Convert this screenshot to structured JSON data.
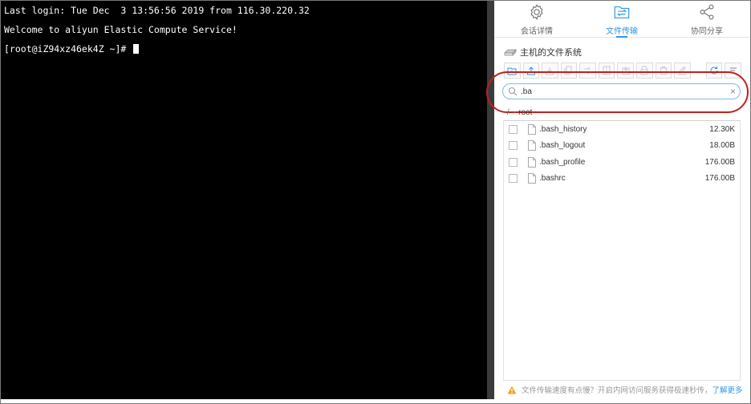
{
  "terminal": {
    "lines": [
      "Last login: Tue Dec  3 13:56:56 2019 from 116.30.220.32",
      "Welcome to aliyun Elastic Compute Service!",
      "[root@iZ94xz46ek4Z ~]# "
    ]
  },
  "tabs": [
    {
      "label": "会话详情",
      "icon": "gear-icon"
    },
    {
      "label": "文件传输",
      "icon": "file-transfer-icon"
    },
    {
      "label": "协同分享",
      "icon": "share-icon"
    }
  ],
  "active_tab": "文件传输",
  "section_title": "主机的文件系统",
  "search": {
    "value": ".ba"
  },
  "breadcrumb": {
    "root": "/",
    "current": "root"
  },
  "files": [
    {
      "name": ".bash_history",
      "size": "12.30K"
    },
    {
      "name": ".bash_logout",
      "size": "18.00B"
    },
    {
      "name": ".bash_profile",
      "size": "176.00B"
    },
    {
      "name": ".bashrc",
      "size": "176.00B"
    }
  ],
  "notice": {
    "text": "文件传输速度有点慢？开启内网访问服务获得极速秒传，",
    "link": "了解更多"
  },
  "colors": {
    "accent": "#2f97e5",
    "highlight_ring": "#c21f1f",
    "terminal_bg": "#000000"
  }
}
